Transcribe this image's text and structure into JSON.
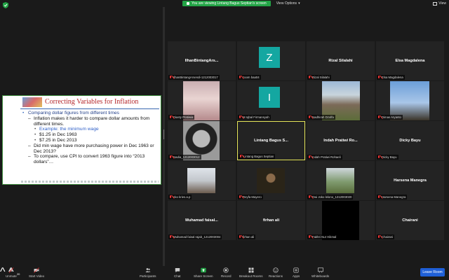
{
  "topbar": {
    "viewing_text": "You are viewing Lintang Bagus Septian's screen",
    "view_options": "View Options",
    "view": "View"
  },
  "slide": {
    "title": "Correcting Variables for Inflation",
    "bullets": [
      {
        "level": 1,
        "text": "Comparing dollar figures from different times"
      },
      {
        "level": 2,
        "text": "Inflation makes it harder to compare dollar amounts from different times."
      },
      {
        "level": 3,
        "blue": true,
        "text": "Example:  the minimum wage"
      },
      {
        "level": 3,
        "text": "$1.25 in Dec 1963"
      },
      {
        "level": 3,
        "text": "$7.25 in Dec 2013"
      },
      {
        "level": 2,
        "text": "Did min wage have more purchasing power in Dec 1963 or Dec 2013?"
      },
      {
        "level": 2,
        "text": "To compare, use CPI to convert 1963 figure into “2013 dollars”…"
      }
    ]
  },
  "participants": [
    {
      "name": "IlhanBintangArs...",
      "label": "IlhanBintangArsendi-1212003017",
      "kind": "name"
    },
    {
      "name": "",
      "label": "zoom baa04",
      "kind": "letter",
      "letter": "Z"
    },
    {
      "name": "Rizal Silalahi",
      "label": "Rizal Silalahi",
      "kind": "name"
    },
    {
      "name": "Elsa Magdalena",
      "label": "Elsa Magdalena",
      "kind": "name"
    },
    {
      "name": "",
      "label": "Diasty Pratiwia",
      "kind": "photo",
      "photo": "pink"
    },
    {
      "name": "",
      "label": "M Iqbal Firmansyah",
      "kind": "letter",
      "letter": "I"
    },
    {
      "name": "",
      "label": "Nadhirah Dzolfa",
      "kind": "photo",
      "photo": "temple"
    },
    {
      "name": "",
      "label": "Dimas Aryanto",
      "kind": "photo",
      "photo": "sky"
    },
    {
      "name": "",
      "label": "Nadia_1212003012",
      "kind": "photo",
      "photo": "cartoon"
    },
    {
      "name": "Lintang Bagus S...",
      "label": "Lintang Bagus Septian",
      "kind": "name",
      "active": true
    },
    {
      "name": "Indah Pratiwi Ro...",
      "label": "Indah Pratiwi Rohaeli",
      "kind": "name"
    },
    {
      "name": "Dicky Bayu",
      "label": "Dicky Bayu",
      "kind": "name"
    },
    {
      "name": "",
      "label": "eko kries.a.p",
      "kind": "photo",
      "photo": "snow"
    },
    {
      "name": "",
      "label": "Reyfa Mayero",
      "kind": "photo",
      "photo": "dark"
    },
    {
      "name": "",
      "label": "Dwi Joko lelono_1212003020",
      "kind": "photo",
      "photo": "green"
    },
    {
      "name": "Harsena Manegra",
      "label": "Harsena Manegra",
      "kind": "name"
    },
    {
      "name": "Muhamad faisal...",
      "label": "Muhamad faisal rajab_1212003004",
      "kind": "name"
    },
    {
      "name": "firhan ali",
      "label": "firhan ali",
      "kind": "name"
    },
    {
      "name": "",
      "label": "Fakhri Nur Hikmal",
      "kind": "black"
    },
    {
      "name": "Chairani",
      "label": "Chairani",
      "kind": "name"
    }
  ],
  "toolbar": {
    "unmute": "Unmute",
    "start_video": "Start Video",
    "participants": "Participants",
    "participants_count": "20",
    "chat": "Chat",
    "share_screen": "Share Screen",
    "record": "Record",
    "breakout_rooms": "Breakout Rooms",
    "reactions": "Reactions",
    "apps": "Apps",
    "whiteboards": "Whiteboards",
    "leave_room": "Leave Room"
  },
  "colors": {
    "accent_green": "#23a446",
    "leave_blue": "#1f5fd7",
    "active_border": "#e6e65a",
    "avatar_teal": "#14a7a1",
    "mic_muted_red": "#e33333"
  }
}
